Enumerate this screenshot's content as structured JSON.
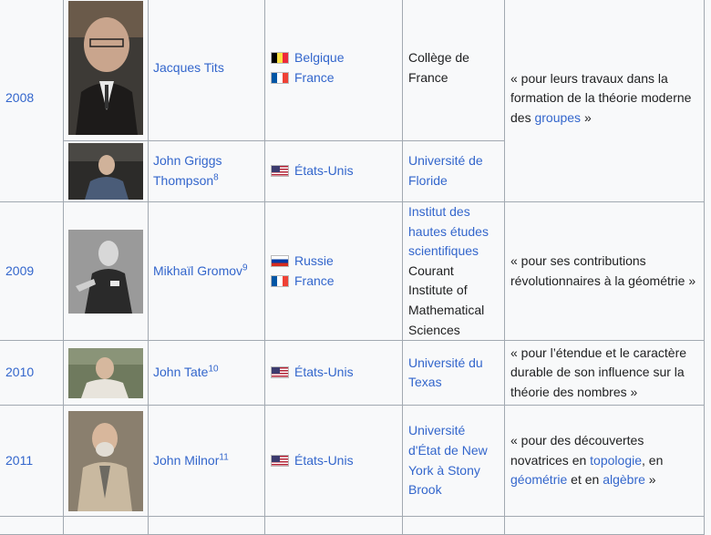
{
  "rows": [
    {
      "year": "2008",
      "laureates": [
        {
          "name": "Jacques Tits",
          "ref": "",
          "photo": "portrait-jacques-tits",
          "countries": [
            {
              "flag": "belgium-flag-icon",
              "name": "Belgique"
            },
            {
              "flag": "france-flag-icon",
              "name": "France"
            }
          ],
          "institution": [
            {
              "text": "Collège de France",
              "link": false
            }
          ]
        },
        {
          "name": "John Griggs Thompson",
          "ref": "8",
          "photo": "portrait-john-griggs-thompson",
          "countries": [
            {
              "flag": "usa-flag-icon",
              "name": "États-Unis"
            }
          ],
          "institution": [
            {
              "text": "Université de Floride",
              "link": true
            }
          ]
        }
      ],
      "reason": {
        "before": "« pour leurs travaux dans la formation de la théorie moderne des ",
        "link1": "groupes",
        "middle": "",
        "link2": "",
        "middle2": "",
        "link3": "",
        "after": " »"
      }
    },
    {
      "year": "2009",
      "laureates": [
        {
          "name": "Mikhaïl Gromov",
          "ref": "9",
          "photo": "portrait-mikhail-gromov",
          "countries": [
            {
              "flag": "russia-flag-icon",
              "name": "Russie"
            },
            {
              "flag": "france-flag-icon",
              "name": "France"
            }
          ],
          "institution": [
            {
              "text": "Institut des hautes études scientifiques",
              "link": true
            },
            {
              "text": "Courant Institute of Mathematical Sciences",
              "link": false
            }
          ]
        }
      ],
      "reason": {
        "before": "« pour ses contributions révolutionnaires à la géométrie »",
        "link1": "",
        "middle": "",
        "link2": "",
        "middle2": "",
        "link3": "",
        "after": ""
      }
    },
    {
      "year": "2010",
      "laureates": [
        {
          "name": "John Tate",
          "ref": "10",
          "photo": "portrait-john-tate",
          "countries": [
            {
              "flag": "usa-flag-icon",
              "name": "États-Unis"
            }
          ],
          "institution": [
            {
              "text": "Université du Texas",
              "link": true
            }
          ]
        }
      ],
      "reason": {
        "before": "« pour l’étendue et le caractère durable de son influence sur la théorie des nombres »",
        "link1": "",
        "middle": "",
        "link2": "",
        "middle2": "",
        "link3": "",
        "after": ""
      }
    },
    {
      "year": "2011",
      "laureates": [
        {
          "name": "John Milnor",
          "ref": "11",
          "photo": "portrait-john-milnor",
          "countries": [
            {
              "flag": "usa-flag-icon",
              "name": "États-Unis"
            }
          ],
          "institution": [
            {
              "text": "Université d'État de New York à Stony Brook",
              "link": true
            }
          ]
        }
      ],
      "reason": {
        "before": "« pour des découvertes novatrices en ",
        "link1": "topologie",
        "middle": ", en ",
        "link2": "géométrie",
        "middle2": " et en ",
        "link3": "algèbre",
        "after": " »"
      }
    }
  ]
}
